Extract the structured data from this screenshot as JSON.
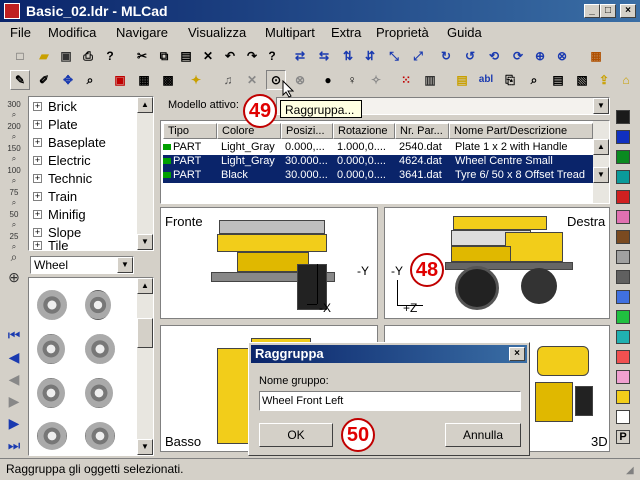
{
  "window": {
    "title": "Basic_02.ldr - MLCad",
    "minimize": "_",
    "maximize": "□",
    "close": "×"
  },
  "menu": [
    "File",
    "Modifica",
    "Navigare",
    "Visualizza",
    "Multipart",
    "Extra",
    "Proprietà",
    "Guida"
  ],
  "zoom_labels": [
    "300",
    "200",
    "150",
    "100",
    "75",
    "50",
    "25"
  ],
  "tree": {
    "items": [
      "Brick",
      "Plate",
      "Baseplate",
      "Electric",
      "Technic",
      "Train",
      "Minifig",
      "Slope",
      "Tile"
    ]
  },
  "part_filter": {
    "value": "Wheel"
  },
  "model": {
    "label": "Modello attivo:",
    "tooltip": "Raggruppa..."
  },
  "table": {
    "headers": [
      "Tipo",
      "Colore",
      "Posizi...",
      "Rotazione",
      "Nr. Par...",
      "Nome Part/Descrizione"
    ],
    "rows": [
      {
        "tipo": "PART",
        "colore": "Light_Gray",
        "pos": "0.000,...",
        "rot": "1.000,0....",
        "nr": "2540.dat",
        "nome": "Plate  1 x  2 with Handle"
      },
      {
        "tipo": "PART",
        "colore": "Light_Gray",
        "pos": "30.000...",
        "rot": "0.000,0....",
        "nr": "4624.dat",
        "nome": "Wheel Centre Small"
      },
      {
        "tipo": "PART",
        "colore": "Black",
        "pos": "30.000...",
        "rot": "0.000,0....",
        "nr": "3641.dat",
        "nome": "Tyre  6/  50 x  8 Offset Tread"
      }
    ]
  },
  "views": {
    "front": "Fronte",
    "right": "Destra",
    "bottom": "Basso",
    "three_d": "3D",
    "axis_y": "-Y",
    "axis_x": "-X",
    "axis_z": "+Z",
    "p_label": "P"
  },
  "callouts": [
    "49",
    "48",
    "50"
  ],
  "dialog": {
    "title": "Raggruppa",
    "label": "Nome gruppo:",
    "value": "Wheel Front Left",
    "ok": "OK",
    "cancel": "Annulla"
  },
  "status": "Raggruppa gli oggetti selezionati.",
  "colors": {
    "accent": "#0a246a",
    "selection": "#0a246a",
    "yellow": "#f2cd1a",
    "callout": "#e00000"
  }
}
